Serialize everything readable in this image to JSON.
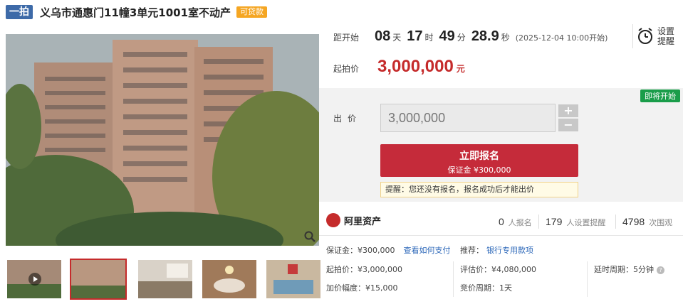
{
  "header": {
    "type_tag": "一拍",
    "title": "义乌市通惠门11幢3单元1001室不动产",
    "loan_badge": "可贷款"
  },
  "countdown": {
    "label": "距开始",
    "days": "08",
    "days_unit": "天",
    "hours": "17",
    "hours_unit": "时",
    "minutes": "49",
    "minutes_unit": "分",
    "seconds": "28.9",
    "seconds_unit": "秒",
    "start_time": "(2025-12-04 10:00开始)"
  },
  "reminder": {
    "line1": "设置",
    "line2": "提醒",
    "icon": "alarm-clock-icon"
  },
  "start_price": {
    "label": "起拍价",
    "value": "3,000,000",
    "unit": "元"
  },
  "bid": {
    "status_badge": "即将开始",
    "label": "出价",
    "input_value": "3,000,000",
    "plus": "+",
    "minus": "−",
    "signup_label": "立即报名",
    "deposit_text": "保证金 ¥300,000",
    "notice": "提醒：您还没有报名，报名成功后才能出价"
  },
  "platform": {
    "name": "阿里资产",
    "signups": "0",
    "signups_unit": "人报名",
    "reminders": "179",
    "reminders_unit": "人设置提醒",
    "views": "4798",
    "views_unit": "次围观"
  },
  "details": {
    "deposit": "保证金：¥300,000",
    "deposit_link": "查看如何支付",
    "recommend_label": "推荐：",
    "recommend_link": "银行专用款项",
    "start_price": "起拍价：¥3,000,000",
    "appraisal": "评估价：¥4,080,000",
    "delay_cycle": "延时周期：5分钟",
    "increment": "加价幅度：¥15,000",
    "bid_cycle": "竞价周期：1天"
  },
  "colors": {
    "accent": "#c52b2b",
    "tag_blue": "#3d6aa8",
    "green": "#1a9d4a",
    "loan": "#f5a623"
  }
}
